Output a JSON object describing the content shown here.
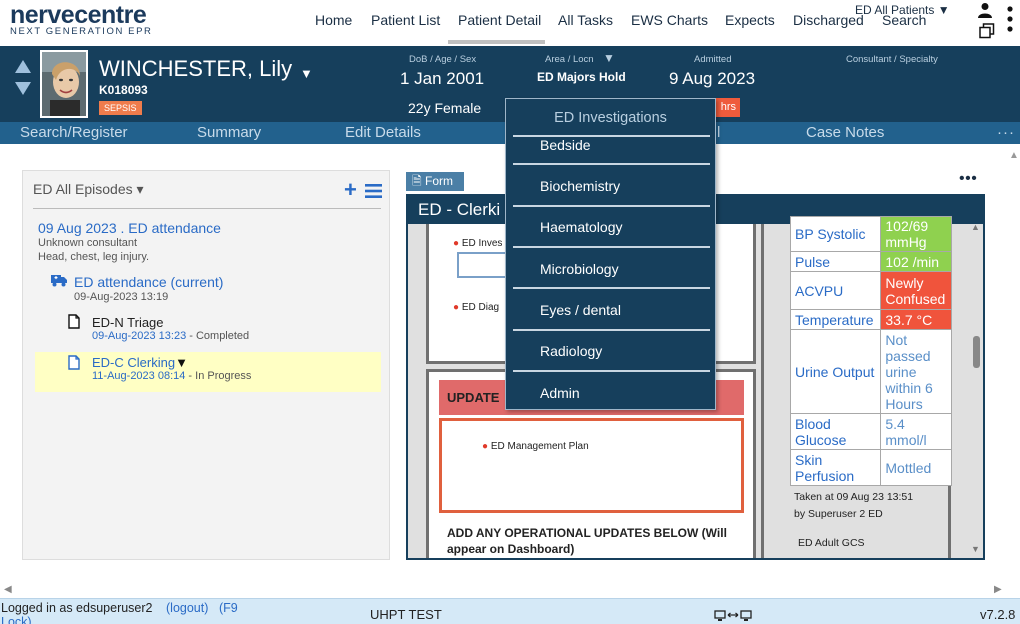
{
  "app": {
    "logo_main": "nervecentre",
    "logo_sub": "NEXT GENERATION EPR"
  },
  "nav": {
    "items": [
      "Home",
      "Patient List",
      "Patient Detail",
      "All Tasks",
      "EWS Charts",
      "Expects",
      "Discharged"
    ],
    "active": "Patient Detail",
    "all_patients": "ED All Patients ▼",
    "search": "Search"
  },
  "patient": {
    "name": "WINCHESTER, Lily",
    "id": "K018093",
    "flag": "SEPSIS",
    "dob_label": "DoB / Age / Sex",
    "dob": "1 Jan 2001",
    "age_sex": "22y Female",
    "area_label": "Area / Locn",
    "area": "ED Majors Hold",
    "admitted_label": "Admitted",
    "admitted": "9 Aug 2023",
    "consultant_label": "Consultant / Specialty",
    "ews_badge": "hrs"
  },
  "subnav": {
    "items": [
      "Search/Register",
      "Summary",
      "Edit Details",
      "l",
      "Case Notes"
    ]
  },
  "episodes": {
    "title": "ED All Episodes ▾",
    "episode_title": "09 Aug 2023 . ED attendance",
    "consultant": "Unknown consultant",
    "complaint": "Head, chest, leg injury.",
    "current_label": "ED attendance (current)",
    "current_date": "09-Aug-2023 13:19",
    "triage": {
      "name": "ED-N Triage",
      "date": "09-Aug-2023 13:23",
      "status": " - Completed"
    },
    "clerking": {
      "name": "ED-C Clerking",
      "caret": "▼",
      "date": "11-Aug-2023 08:14",
      "status": " - In Progress"
    }
  },
  "form": {
    "tab_label": "Form",
    "header": "ED - Clerki",
    "inv_label": "ED Inves",
    "diag_label": "ED Diag",
    "update_header": "UPDATE",
    "mgmt_label": "ED Management Plan",
    "ops_text": "ADD ANY OPERATIONAL UPDATES BELOW (Will appear on Dashboard)"
  },
  "vitals": {
    "rows": [
      {
        "label": "BP Systolic",
        "value": "102/69 mmHg",
        "status": "green"
      },
      {
        "label": "Pulse",
        "value": "102 /min",
        "status": "green"
      },
      {
        "label": "ACVPU",
        "value": "Newly Confused",
        "status": "red"
      },
      {
        "label": "Temperature",
        "value": "33.7 °C",
        "status": "red"
      },
      {
        "label": "Urine Output",
        "value": "Not passed urine within 6 Hours",
        "status": "plain"
      },
      {
        "label": "Blood Glucose",
        "value": "5.4 mmol/l",
        "status": "plain"
      },
      {
        "label": "Skin Perfusion",
        "value": "Mottled",
        "status": "plain"
      }
    ],
    "taken_at": "Taken at 09 Aug 23 13:51",
    "taken_by": "by Superuser 2 ED",
    "gcs_label": "ED Adult GCS"
  },
  "dropdown": {
    "title": "ED Investigations",
    "items": [
      "Bedside",
      "Biochemistry",
      "Haematology",
      "Microbiology",
      "Eyes / dental",
      "Radiology",
      "Admin"
    ]
  },
  "status": {
    "login": "Logged in as edsuperuser2",
    "logout": "(logout)",
    "lock": "(F9",
    "lock2": "Lock)",
    "site": "UHPT TEST",
    "version": "v7.2.8"
  },
  "colors": {
    "banner": "#163f5c",
    "subnav": "#22618d",
    "link_blue": "#2a6bc6",
    "alert_green": "#8fd14f",
    "alert_red": "#f0543c",
    "sepsis": "#ef7c4c",
    "in_progress_highlight": "#ffffc4"
  }
}
